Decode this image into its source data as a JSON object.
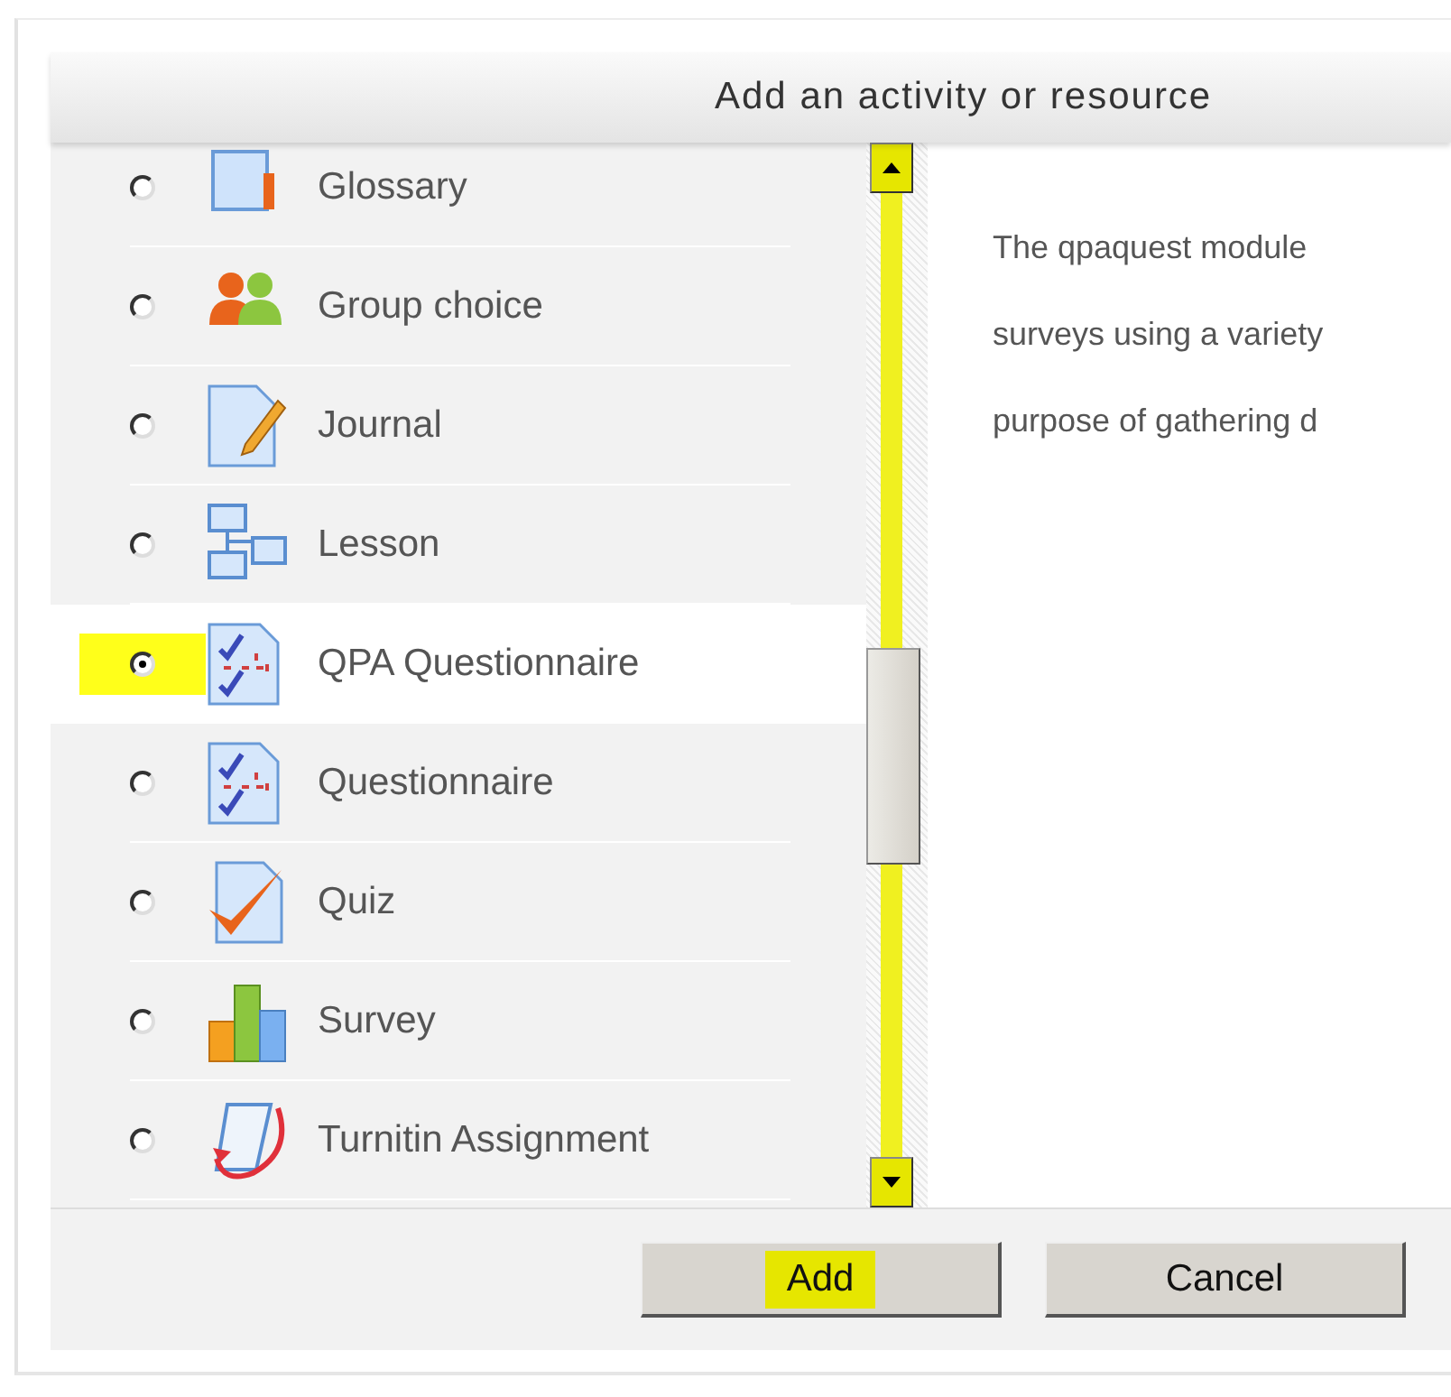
{
  "dialog": {
    "title": "Add an activity or resource"
  },
  "options": [
    {
      "label": "Glossary",
      "kind": "glossary",
      "selected": false,
      "highlighted": false
    },
    {
      "label": "Group choice",
      "kind": "people",
      "selected": false,
      "highlighted": false
    },
    {
      "label": "Journal",
      "kind": "journal",
      "selected": false,
      "highlighted": false
    },
    {
      "label": "Lesson",
      "kind": "lesson",
      "selected": false,
      "highlighted": false
    },
    {
      "label": "QPA Questionnaire",
      "kind": "checklist",
      "selected": true,
      "highlighted": true
    },
    {
      "label": "Questionnaire",
      "kind": "checklist",
      "selected": false,
      "highlighted": false
    },
    {
      "label": "Quiz",
      "kind": "quiz",
      "selected": false,
      "highlighted": false
    },
    {
      "label": "Survey",
      "kind": "chart",
      "selected": false,
      "highlighted": false
    },
    {
      "label": "Turnitin Assignment",
      "kind": "turnitin",
      "selected": false,
      "highlighted": false
    }
  ],
  "description": [
    "The qpaquest module",
    "surveys using a variety",
    "purpose of gathering d"
  ],
  "buttons": [
    {
      "label": "Add",
      "highlighted": true
    },
    {
      "label": "Cancel",
      "highlighted": false
    }
  ]
}
